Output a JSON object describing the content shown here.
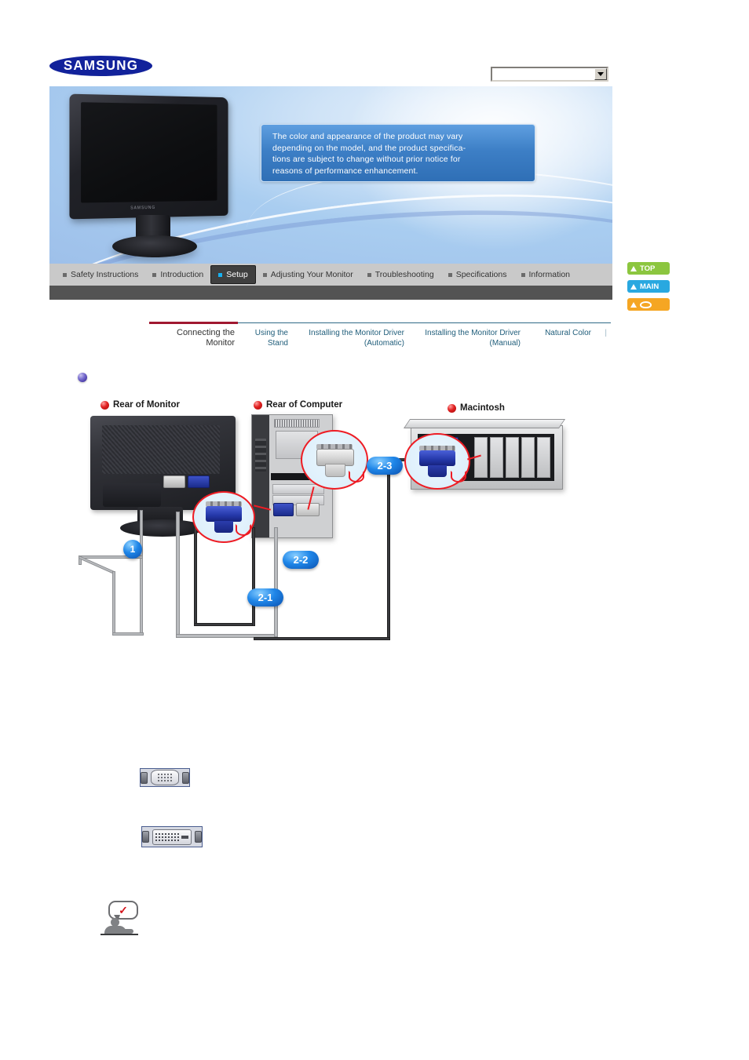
{
  "brand": {
    "logo_text": "SAMSUNG",
    "logo_color": "#12229b"
  },
  "model_select": {
    "value": "",
    "placeholder": "",
    "icon": "chevron-down-icon"
  },
  "banner": {
    "notice": "The color and appearance of the product may vary\ndepending on the model, and the product specifica-\ntions are subject to change without prior notice for\nreasons of performance enhancement.",
    "product_brand_plate": "SAMSUNG"
  },
  "main_nav": {
    "items": [
      {
        "label": "Safety Instructions",
        "active": false
      },
      {
        "label": "Introduction",
        "active": false
      },
      {
        "label": "Setup",
        "active": true
      },
      {
        "label": "Adjusting Your Monitor",
        "active": false
      },
      {
        "label": "Troubleshooting",
        "active": false
      },
      {
        "label": "Specifications",
        "active": false
      },
      {
        "label": "Information",
        "active": false
      }
    ]
  },
  "side_buttons": [
    {
      "label": "TOP",
      "icon": "arrow-up-icon",
      "color": "#8cc63f"
    },
    {
      "label": "MAIN",
      "icon": "arrow-up-flag-icon",
      "color": "#29a8e0"
    },
    {
      "label": "",
      "icon": "arrow-up-book-icon",
      "color": "#f5a623"
    }
  ],
  "sub_nav": {
    "items": [
      {
        "label": "Connecting  the\nMonitor",
        "active": true
      },
      {
        "label": "Using the\nStand",
        "active": false
      },
      {
        "label": "Installing the Monitor Driver\n(Automatic)",
        "active": false
      },
      {
        "label": "Installing the Monitor Driver\n(Manual)",
        "active": false
      },
      {
        "label": "Natural Color",
        "active": false
      },
      {
        "label": "|",
        "active": false
      }
    ],
    "active_rule_color": "#a01830"
  },
  "section": {
    "bullet_icon": "purple-sphere-bullet-icon",
    "heading": ""
  },
  "diagram": {
    "labels": [
      {
        "text": "Rear of Monitor",
        "bullet": "red-sphere-bullet-icon"
      },
      {
        "text": "Rear of Computer",
        "bullet": "red-sphere-bullet-icon"
      },
      {
        "text": "Macintosh",
        "bullet": "red-sphere-bullet-icon"
      }
    ],
    "badges": [
      {
        "text": "1",
        "shape": "circle"
      },
      {
        "text": "2-1",
        "shape": "pill"
      },
      {
        "text": "2-2",
        "shape": "pill"
      },
      {
        "text": "2-3",
        "shape": "pill"
      }
    ],
    "callouts": [
      {
        "name": "monitor-vga-plug-callout",
        "plug": "vga-blue"
      },
      {
        "name": "computer-dvi-plug-callout",
        "plug": "dvi-grey"
      },
      {
        "name": "macintosh-vga-plug-callout",
        "plug": "vga-blue"
      }
    ]
  },
  "connectors": [
    {
      "name": "d-sub-connector-figure",
      "caption": ""
    },
    {
      "name": "dvi-connector-figure",
      "caption": ""
    }
  ],
  "note": {
    "icon": "note-person-check-icon",
    "text": ""
  }
}
